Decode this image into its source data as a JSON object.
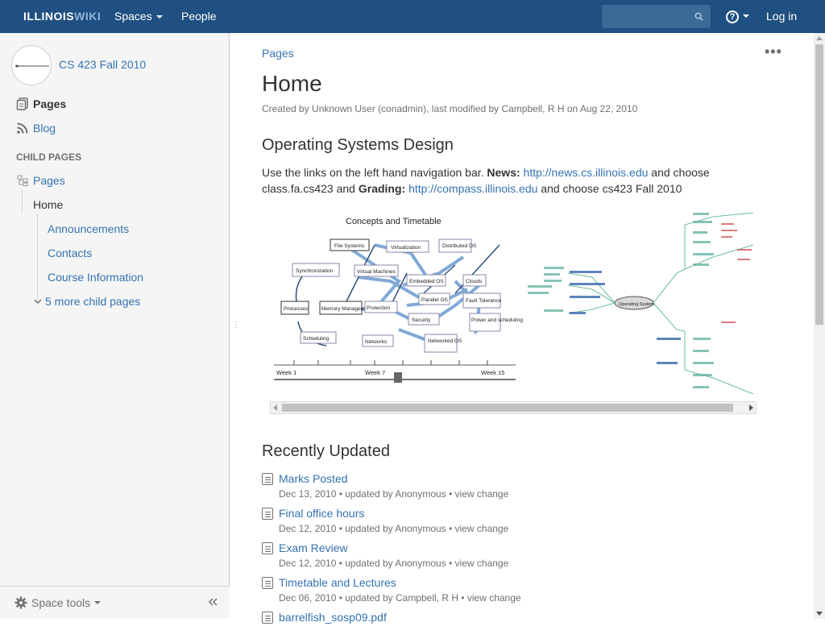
{
  "header": {
    "logo_main": "ILLINOIS",
    "logo_sub": "WIKI",
    "spaces": "Spaces",
    "people": "People",
    "search_placeholder": "",
    "login": "Log in"
  },
  "sidebar": {
    "space_title": "CS 423 Fall 2010",
    "pages": "Pages",
    "blog": "Blog",
    "child_pages_heading": "CHILD PAGES",
    "tree": {
      "root": "Pages",
      "home": "Home",
      "children": [
        "Announcements",
        "Contacts",
        "Course Information"
      ],
      "more": "5 more child pages"
    },
    "space_tools": "Space tools"
  },
  "content": {
    "breadcrumb": "Pages",
    "more_actions": "•••",
    "title": "Home",
    "meta": "Created by Unknown User (conadmin), last modified by Campbell, R H on Aug 22, 2010",
    "section_title": "Operating Systems Design",
    "intro": {
      "part1": "Use the links on the left hand navigation bar. ",
      "news_label": "News:",
      "news_link": "http://news.cs.illinois.edu",
      "part2": " and choose class.fa.cs423 and ",
      "grading_label": "Grading:",
      "grading_link": "http://compass.illinois.edu",
      "part3": " and choose cs423 Fall 2010"
    },
    "figure": {
      "title": "Concepts and Timetable",
      "week_labels": [
        "Week 1",
        "Week 7",
        "Week 15"
      ],
      "nodes": [
        "File Systems",
        "Virtualization",
        "Distributed OS",
        "Synchronization",
        "Virtual Machines",
        "Processes",
        "Memory Management",
        "Protection",
        "Scheduling",
        "Networks",
        "Networked OS",
        "Security",
        "Embedded OS",
        "Clouds",
        "Parallel OS",
        "Fault Tolerance",
        "Power and scheduling"
      ],
      "mindmap_center": "Operating System"
    },
    "recently_updated_title": "Recently Updated",
    "recent": [
      {
        "title": "Marks Posted",
        "meta": "Dec 13, 2010 • updated by Anonymous • view change"
      },
      {
        "title": "Final office hours",
        "meta": "Dec 12, 2010 • updated by Anonymous • view change"
      },
      {
        "title": "Exam Review",
        "meta": "Dec 12, 2010 • updated by Anonymous • view change"
      },
      {
        "title": "Timetable and Lectures",
        "meta": "Dec 06, 2010 • updated by Campbell, R H • view change"
      },
      {
        "title": "barrelfish_sosp09.pdf",
        "meta": ""
      }
    ]
  },
  "colors": {
    "header_bg": "#205081",
    "link": "#3572b0",
    "sidebar_bg": "#f5f5f5"
  }
}
